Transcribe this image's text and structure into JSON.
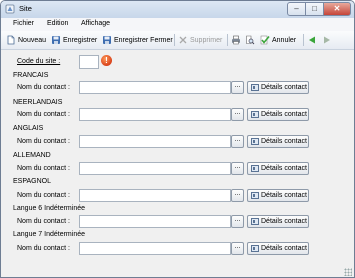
{
  "window": {
    "title": "Site",
    "controls": [
      "–",
      "□",
      "✕"
    ]
  },
  "menu": {
    "items": [
      "Fichier",
      "Edition",
      "Affichage"
    ]
  },
  "toolbar": {
    "new_label": "Nouveau",
    "save_label": "Enregistrer",
    "save_close_label": "Enregistrer Fermer",
    "delete_label": "Supprimer",
    "cancel_label": "Annuler"
  },
  "form": {
    "code_label": "Code du site :",
    "code_value": "",
    "error_icon_glyph": "!",
    "contact_label": "Nom du contact :",
    "browse_label": "...",
    "details_label": "Détails contact",
    "languages": [
      {
        "name": "FRANCAIS",
        "contact": ""
      },
      {
        "name": "NEERLANDAIS",
        "contact": ""
      },
      {
        "name": "ANGLAIS",
        "contact": ""
      },
      {
        "name": "ALLEMAND",
        "contact": ""
      },
      {
        "name": "ESPAGNOL",
        "contact": ""
      },
      {
        "name": "Langue 6 Indéterminée",
        "contact": ""
      },
      {
        "name": "Langue 7 Indéterminée",
        "contact": ""
      }
    ]
  },
  "colors": {
    "title_bar": "#c7d7ea",
    "close_button": "#c4453a",
    "error_icon": "#d8411a",
    "toolbar_green": "#3aa53a"
  }
}
